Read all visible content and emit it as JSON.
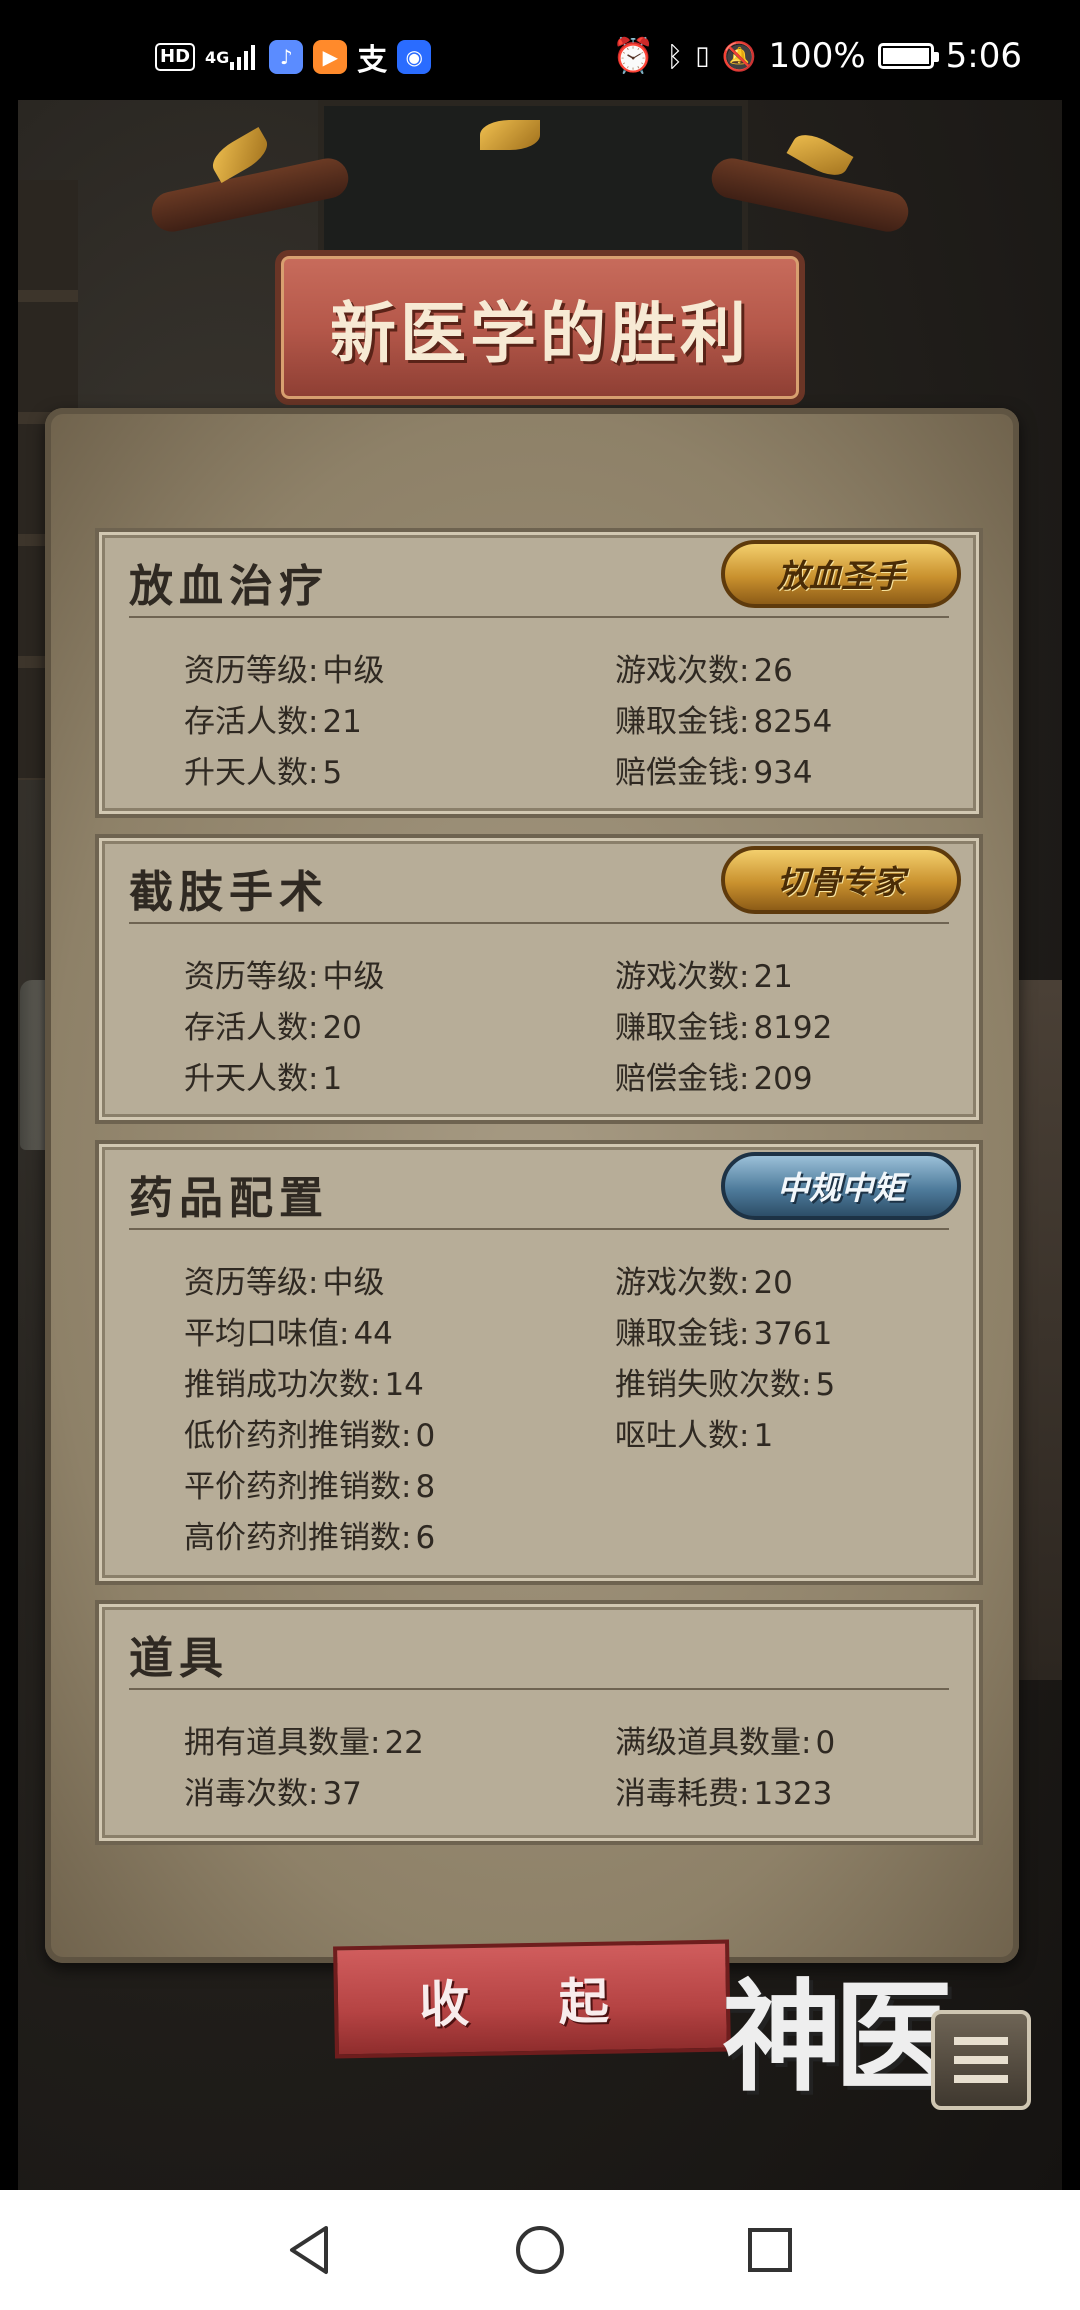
{
  "status_bar": {
    "left_icons": [
      "HD",
      "4G",
      "music-app-icon",
      "video-app-icon",
      "alipay-icon",
      "lightbulb-app-icon"
    ],
    "hd": "HD",
    "network": "4G",
    "alipay": "支",
    "battery": "100%",
    "time": "5:06"
  },
  "title": "新医学的胜利",
  "panels": [
    {
      "title": "放血治疗",
      "badge": "放血圣手",
      "badge_style": "gold",
      "stats": [
        {
          "label": "资历等级",
          "value": "中级"
        },
        {
          "label": "游戏次数",
          "value": "26"
        },
        {
          "label": "存活人数",
          "value": "21"
        },
        {
          "label": "赚取金钱",
          "value": "8254"
        },
        {
          "label": "升天人数",
          "value": "5"
        },
        {
          "label": "赔偿金钱",
          "value": "934"
        }
      ]
    },
    {
      "title": "截肢手术",
      "badge": "切骨专家",
      "badge_style": "gold",
      "stats": [
        {
          "label": "资历等级",
          "value": "中级"
        },
        {
          "label": "游戏次数",
          "value": "21"
        },
        {
          "label": "存活人数",
          "value": "20"
        },
        {
          "label": "赚取金钱",
          "value": "8192"
        },
        {
          "label": "升天人数",
          "value": "1"
        },
        {
          "label": "赔偿金钱",
          "value": "209"
        }
      ]
    },
    {
      "title": "药品配置",
      "badge": "中规中矩",
      "badge_style": "blue",
      "stats": [
        {
          "label": "资历等级",
          "value": "中级"
        },
        {
          "label": "游戏次数",
          "value": "20"
        },
        {
          "label": "平均口味值",
          "value": "44"
        },
        {
          "label": "赚取金钱",
          "value": "3761"
        },
        {
          "label": "推销成功次数",
          "value": "14"
        },
        {
          "label": "推销失败次数",
          "value": "5"
        },
        {
          "label": "低价药剂推销数",
          "value": "0"
        },
        {
          "label": "呕吐人数",
          "value": "1"
        },
        {
          "label": "平价药剂推销数",
          "value": "8"
        },
        {
          "label": "高价药剂推销数",
          "value": "6"
        }
      ]
    },
    {
      "title": "道具",
      "stats": [
        {
          "label": "拥有道具数量",
          "value": "22"
        },
        {
          "label": "满级道具数量",
          "value": "0"
        },
        {
          "label": "消毒次数",
          "value": "37"
        },
        {
          "label": "消毒耗费",
          "value": "1323"
        }
      ]
    }
  ],
  "collapse_button": "收 起",
  "logo_text": "神医",
  "nav": [
    "back-icon",
    "home-icon",
    "recents-icon"
  ]
}
